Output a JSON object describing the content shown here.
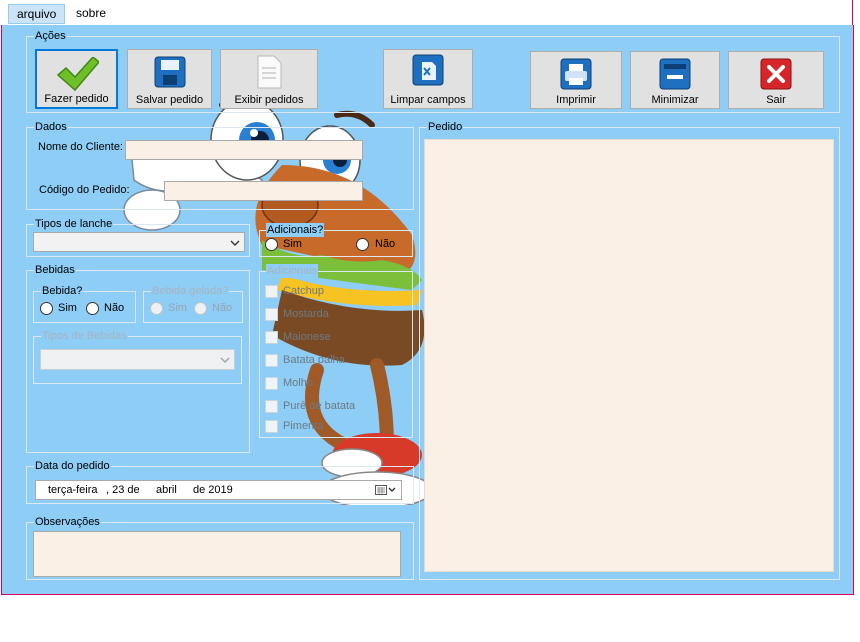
{
  "menu": {
    "items": [
      "arquivo",
      "sobre"
    ]
  },
  "acoes": {
    "title": "Ações",
    "buttons": [
      {
        "name": "fazer-pedido",
        "label": "Fazer pedido"
      },
      {
        "name": "salvar-pedido",
        "label": "Salvar pedido"
      },
      {
        "name": "exibir-pedidos",
        "label": "Exibir pedidos"
      },
      {
        "name": "limpar-campos",
        "label": "Limpar campos"
      },
      {
        "name": "imprimir",
        "label": "Imprimir"
      },
      {
        "name": "minimizar",
        "label": "Minimizar"
      },
      {
        "name": "sair",
        "label": "Sair"
      }
    ]
  },
  "dados": {
    "title": "Dados",
    "cliente_label": "Nome do Cliente:",
    "cliente_value": "",
    "codigo_label": "Código do Pedido:",
    "codigo_value": ""
  },
  "tipos_lanche": {
    "title": "Tipos de lanche",
    "selected": ""
  },
  "adicionais_q": {
    "title": "Adicionais?",
    "sim": "Sim",
    "nao": "Não"
  },
  "bebidas": {
    "title": "Bebidas",
    "bebida_q": {
      "title": "Bebida?",
      "sim": "Sim",
      "nao": "Não"
    },
    "gelada_q": {
      "title": "Bebida gelada?",
      "sim": "Sim",
      "nao": "Não"
    },
    "tipos": {
      "title": "Tipos de Bebidas",
      "selected": ""
    }
  },
  "adicionais": {
    "title": "Adicionais",
    "items": [
      "Catchup",
      "Mostarda",
      "Maionese",
      "Batata palha",
      "Molho",
      "Purê de batata",
      "Pimenta"
    ]
  },
  "data_pedido": {
    "title": "Data do pedido",
    "weekday": "terça-feira",
    "day": ", 23 de",
    "month": "abril",
    "year": "de 2019"
  },
  "observacoes": {
    "title": "Observações",
    "value": ""
  },
  "pedido": {
    "title": "Pedido",
    "value": ""
  },
  "colors": {
    "background": "#8dcdf6",
    "input": "#faf0e6",
    "accent": "#0078d7",
    "frame": "#d4006a"
  }
}
